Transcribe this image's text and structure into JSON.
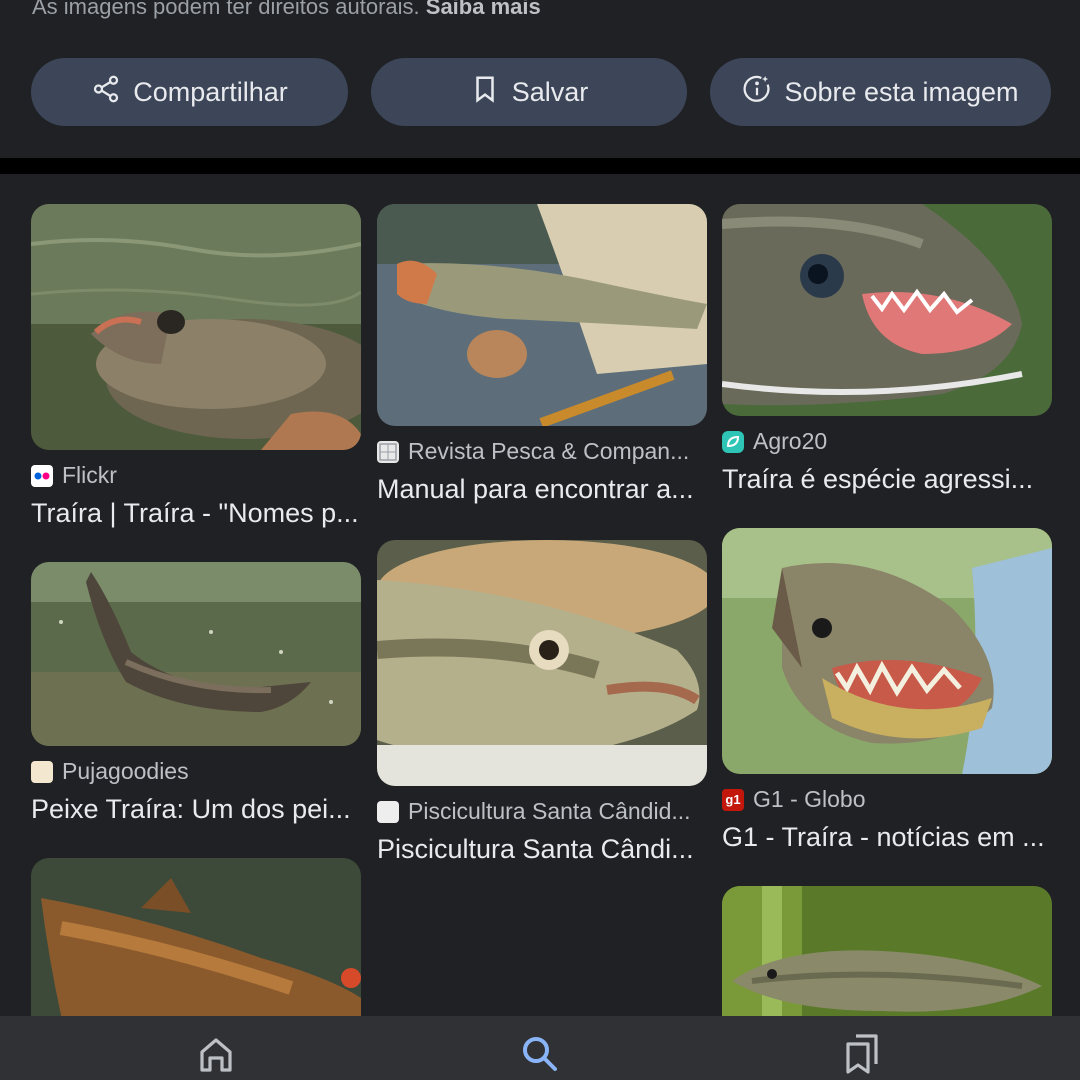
{
  "header": {
    "copyright_text": "As imagens podem ter direitos autorais.",
    "learn_more": "Saiba mais"
  },
  "actions": {
    "share": {
      "label": "Compartilhar",
      "icon": "share-icon"
    },
    "save": {
      "label": "Salvar",
      "icon": "bookmark-icon"
    },
    "about": {
      "label": "Sobre esta imagem",
      "icon": "about-image-icon"
    }
  },
  "results": [
    {
      "source": "Flickr",
      "caption": "Traíra | Traíra - \"Nomes p...",
      "favicon": "flickr-favicon"
    },
    {
      "source": "Pujagoodies",
      "caption": "Peixe Traíra: Um dos pei...",
      "favicon": "pujagoodies-favicon"
    },
    {
      "source": "Revista Pesca & Compan...",
      "caption": "Manual para encontrar a...",
      "favicon": "revista-pesca-favicon"
    },
    {
      "source": "Piscicultura Santa Cândid...",
      "caption": "Piscicultura Santa Cândi...",
      "favicon": "piscicultura-favicon"
    },
    {
      "source": "Agro20",
      "caption": "Traíra é espécie agressi...",
      "favicon": "agro20-favicon"
    },
    {
      "source": "G1 - Globo",
      "caption": "G1 - Traíra - notícias em ...",
      "favicon": "g1-favicon",
      "favicon_text": "g1"
    }
  ],
  "nav": {
    "home": "home-icon",
    "search": "search-icon",
    "saved": "saved-collections-icon",
    "active": "search",
    "active_color": "#8ab4f8"
  },
  "colors": {
    "background": "#202124",
    "button_bg": "#3c4658",
    "accent": "#8ab4f8"
  }
}
